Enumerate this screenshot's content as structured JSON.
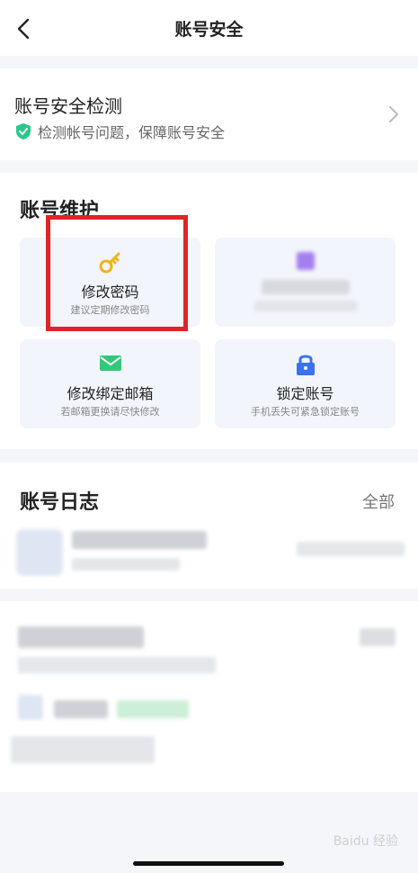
{
  "header": {
    "title": "账号安全"
  },
  "detect": {
    "title": "账号安全检测",
    "desc": "检测帐号问题，保障账号安全"
  },
  "maintenance": {
    "title": "账号维护",
    "cards": [
      {
        "title": "修改密码",
        "desc": "建议定期修改密码",
        "icon": "key-icon"
      },
      {
        "title": "",
        "desc": "",
        "icon": "blurred-icon"
      },
      {
        "title": "修改绑定邮箱",
        "desc": "若邮箱更换请尽快修改",
        "icon": "mail-icon"
      },
      {
        "title": "锁定账号",
        "desc": "手机丢失可紧急锁定账号",
        "icon": "lock-icon"
      }
    ]
  },
  "log": {
    "title": "账号日志",
    "all_label": "全部"
  },
  "colors": {
    "accent_gold": "#f0b31c",
    "mail_green": "#32c87a",
    "lock_blue": "#3a72f0",
    "highlight_red": "#e0242a",
    "shield_green": "#2cc58a"
  }
}
